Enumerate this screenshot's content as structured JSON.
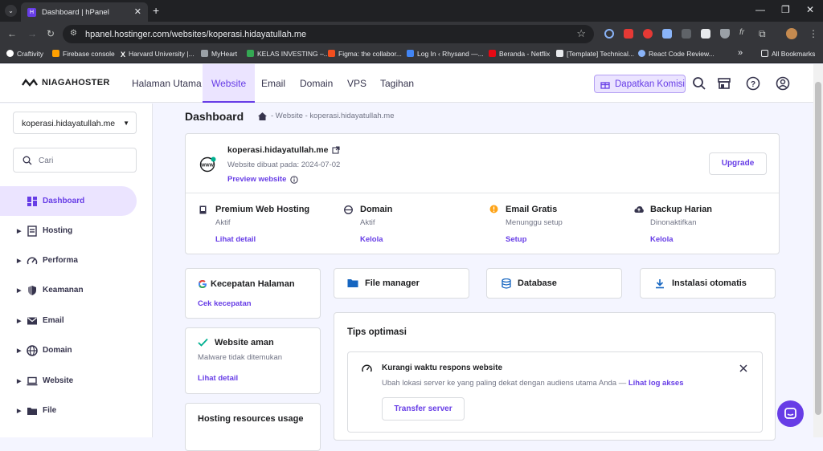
{
  "browser": {
    "tab_title": "Dashboard | hPanel",
    "url": "hpanel.hostinger.com/websites/koperasi.hidayatullah.me"
  },
  "bookmarks": [
    "Craftivity",
    "Firebase console",
    "Harvard University |...",
    "MyHeart",
    "KELAS INVESTING –...",
    "Figma: the collabor...",
    "Log In ‹ Rhysand —...",
    "Beranda - Netflix",
    "[Template] Technical...",
    "React Code Review..."
  ],
  "bookmarks_more": "»",
  "all_bookmarks": "All Bookmarks",
  "header": {
    "logo": "NIAGAHOSTER",
    "menu": [
      "Halaman Utama",
      "Website",
      "Email",
      "Domain",
      "VPS",
      "Tagihan"
    ],
    "active": "Website",
    "komisi": "Dapatkan Komisi"
  },
  "sidebar": {
    "site": "koperasi.hidayatullah.me",
    "search_placeholder": "Cari",
    "items": [
      "Dashboard",
      "Hosting",
      "Performa",
      "Keamanan",
      "Email",
      "Domain",
      "Website",
      "File"
    ]
  },
  "page": {
    "title": "Dashboard",
    "breadcrumb": "- Website - koperasi.hidayatullah.me"
  },
  "site_card": {
    "domain": "koperasi.hidayatullah.me",
    "created": "Website dibuat pada: 2024-07-02",
    "preview": "Preview website",
    "upgrade": "Upgrade",
    "www": "WWW"
  },
  "services": [
    {
      "title": "Premium Web Hosting",
      "status": "Aktif",
      "action": "Lihat detail"
    },
    {
      "title": "Domain",
      "status": "Aktif",
      "action": "Kelola"
    },
    {
      "title": "Email Gratis",
      "status": "Menunggu setup",
      "action": "Setup"
    },
    {
      "title": "Backup Harian",
      "status": "Dinonaktifkan",
      "action": "Kelola"
    }
  ],
  "speed": {
    "title": "Kecepatan Halaman",
    "action": "Cek kecepatan"
  },
  "security": {
    "title": "Website aman",
    "desc": "Malware tidak ditemukan",
    "action": "Lihat detail"
  },
  "resources": {
    "title": "Hosting resources usage"
  },
  "quick": [
    "File manager",
    "Database",
    "Instalasi otomatis"
  ],
  "tips": {
    "title": "Tips optimasi",
    "item_title": "Kurangi waktu respons website",
    "item_desc": "Ubah lokasi server ke yang paling dekat dengan audiens utama Anda —",
    "item_link": "Lihat log akses",
    "button": "Transfer server"
  },
  "colors": {
    "primary": "#673de6",
    "warning": "#fea419",
    "success": "#00b090"
  }
}
